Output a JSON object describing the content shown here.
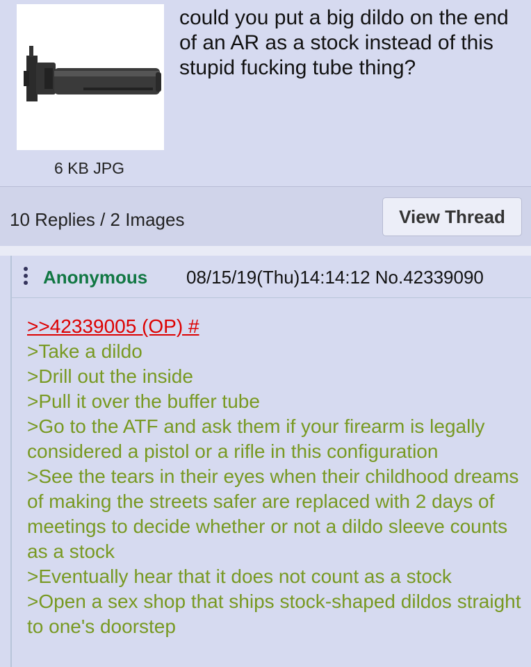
{
  "op": {
    "text": "could you put a big dildo on the end of an AR as a stock instead of this stupid fucking tube thing?",
    "file_info": "6 KB JPG",
    "replies_summary": "10 Replies / 2 Images",
    "view_thread_label": "View Thread"
  },
  "reply": {
    "name": "Anonymous",
    "datetime_no": "08/15/19(Thu)14:14:12 No.42339090",
    "quote_link": ">>42339005 (OP) #",
    "body": ">Take a dildo\n>Drill out the inside\n>Pull it over the buffer tube\n>Go to the ATF and ask them if your firearm is legally considered a pistol or a rifle in this configuration\n>See the tears in their eyes when their childhood dreams of making the streets safer are replaced with 2 days of meetings to decide whether or not a dildo sleeve counts as a stock\n>Eventually hear that it does not count as a stock\n>Open a sex shop that ships stock-shaped dildos straight to one's doorstep"
  },
  "colors": {
    "post_bg": "#d6daf0",
    "name_green": "#117743",
    "greentext": "#789922",
    "quote_red": "#dd0000"
  }
}
